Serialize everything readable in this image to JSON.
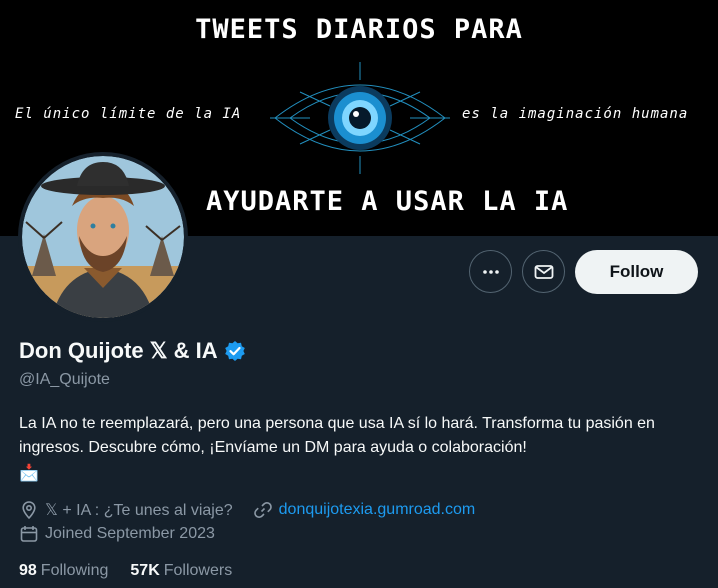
{
  "banner": {
    "top_text": "TWEETS DIARIOS PARA",
    "left_text": "El único límite de la IA",
    "right_text": "es la imaginación humana",
    "bottom_text": "AYUDARTE A USAR LA IA"
  },
  "actions": {
    "follow_label": "Follow"
  },
  "profile": {
    "display_name": "Don Quijote 𝕏 & IA",
    "handle": "@IA_Quijote",
    "bio": "La IA no te reemplazará, pero una persona que usa IA sí lo hará. Transforma tu pasión en ingresos. Descubre cómo, ¡Envíame un DM para ayuda o colaboración!",
    "bio_emoji": "📩",
    "location": "𝕏 + IA : ¿Te unes al viaje?",
    "website": "donquijotexia.gumroad.com",
    "joined": "Joined September 2023"
  },
  "stats": {
    "following_count": "98",
    "following_label": "Following",
    "followers_count": "57K",
    "followers_label": "Followers"
  },
  "colors": {
    "background": "#15202b",
    "accent": "#1d9bf0",
    "secondary_text": "#8b98a5"
  }
}
